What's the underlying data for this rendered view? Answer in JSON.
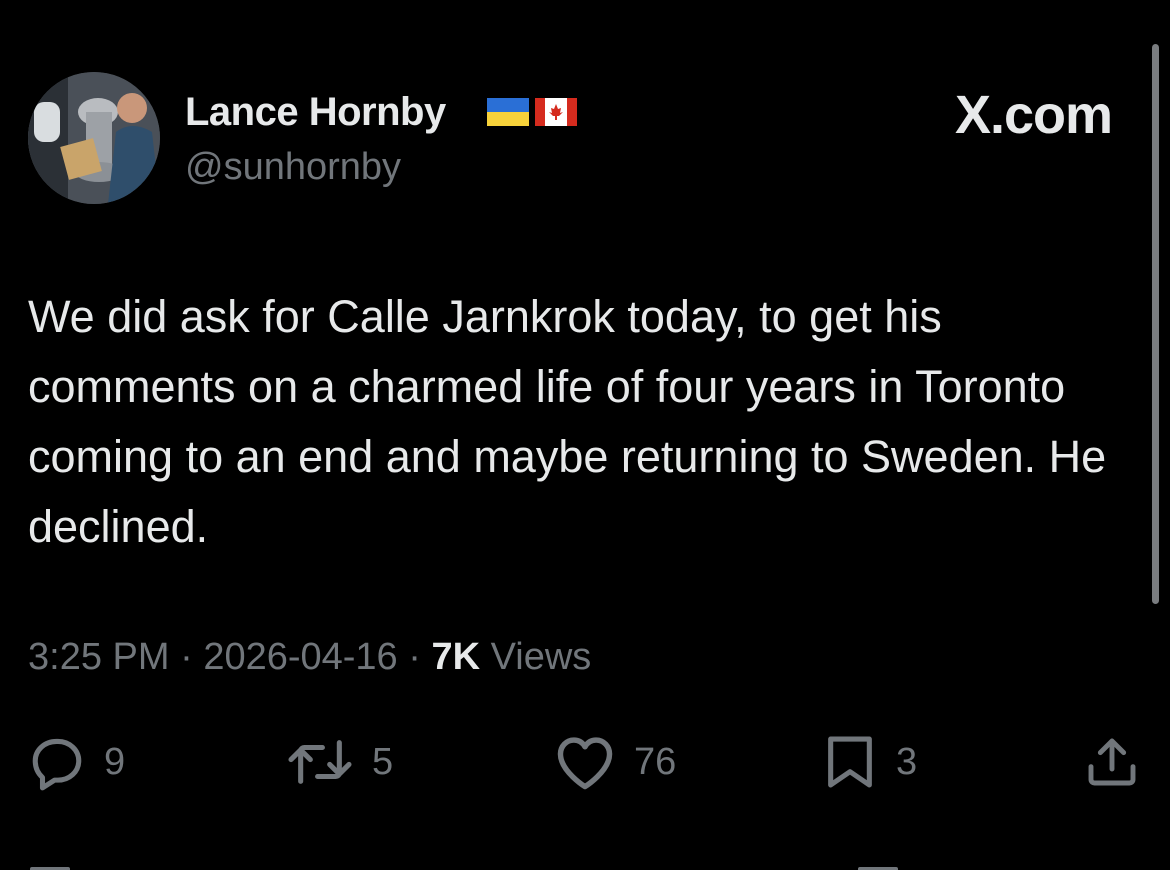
{
  "author": {
    "display_name": "Lance Hornby",
    "handle": "@sunhornby",
    "flags": [
      "ukraine-flag",
      "canada-flag"
    ]
  },
  "brand": "X.com",
  "tweet": {
    "text": "We did ask for Calle Jarnkrok today, to get his comments on a charmed life of four years in Toronto coming to an end and maybe returning to Sweden. He declined."
  },
  "meta": {
    "time": "3:25 PM",
    "separator": "·",
    "date": "2026-04-16",
    "views_count": "7K",
    "views_label": "Views"
  },
  "actions": {
    "replies": "9",
    "reposts": "5",
    "likes": "76",
    "bookmarks": "3"
  },
  "colors": {
    "background": "#000000",
    "text_primary": "#e7e9ea",
    "text_secondary": "#71767b"
  }
}
